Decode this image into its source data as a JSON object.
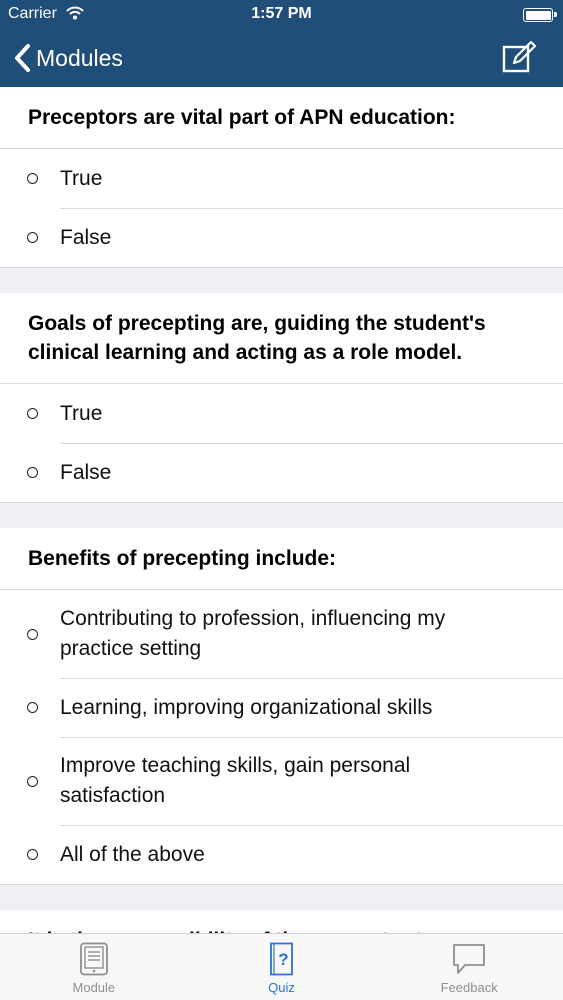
{
  "status": {
    "carrier": "Carrier",
    "time": "1:57 PM"
  },
  "nav": {
    "back_label": "Modules"
  },
  "questions": [
    {
      "title": "Preceptors are vital part of APN education:",
      "options": [
        "True",
        "False"
      ]
    },
    {
      "title": "Goals of precepting are, guiding the student's clinical learning and acting as a role model.",
      "options": [
        "True",
        "False"
      ]
    },
    {
      "title": "Benefits of precepting include:",
      "options": [
        "Contributing to profession, influencing my practice setting",
        "Learning, improving organizational skills",
        "Improve teaching skills, gain personal satisfaction",
        "All of the above"
      ]
    },
    {
      "title": "It is the responsibility of the preceptor to",
      "options": []
    }
  ],
  "tabs": [
    {
      "label": "Module",
      "icon": "tablet-icon",
      "active": false
    },
    {
      "label": "Quiz",
      "icon": "quiz-icon",
      "active": true
    },
    {
      "label": "Feedback",
      "icon": "speech-bubble-icon",
      "active": false
    }
  ],
  "colors": {
    "nav_bg": "#1f4e79",
    "accent": "#2a72d6",
    "inactive": "#8e8e93"
  }
}
